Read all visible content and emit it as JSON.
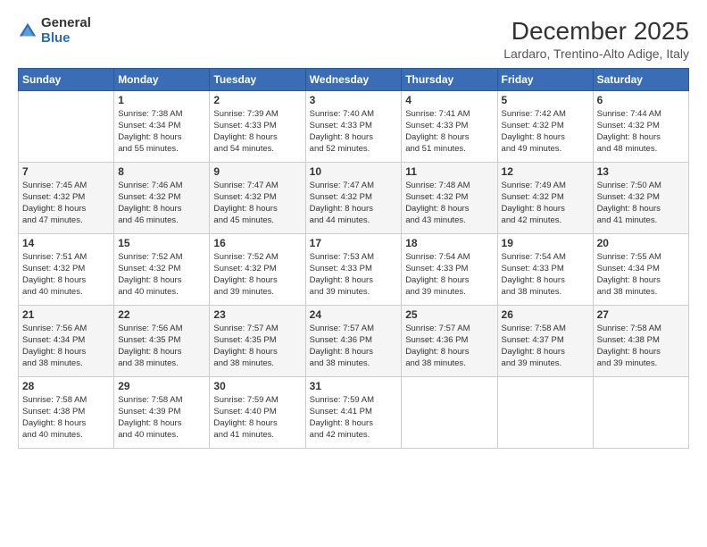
{
  "logo": {
    "general": "General",
    "blue": "Blue"
  },
  "header": {
    "month": "December 2025",
    "location": "Lardaro, Trentino-Alto Adige, Italy"
  },
  "weekdays": [
    "Sunday",
    "Monday",
    "Tuesday",
    "Wednesday",
    "Thursday",
    "Friday",
    "Saturday"
  ],
  "weeks": [
    [
      {
        "day": "",
        "info": ""
      },
      {
        "day": "1",
        "info": "Sunrise: 7:38 AM\nSunset: 4:34 PM\nDaylight: 8 hours\nand 55 minutes."
      },
      {
        "day": "2",
        "info": "Sunrise: 7:39 AM\nSunset: 4:33 PM\nDaylight: 8 hours\nand 54 minutes."
      },
      {
        "day": "3",
        "info": "Sunrise: 7:40 AM\nSunset: 4:33 PM\nDaylight: 8 hours\nand 52 minutes."
      },
      {
        "day": "4",
        "info": "Sunrise: 7:41 AM\nSunset: 4:33 PM\nDaylight: 8 hours\nand 51 minutes."
      },
      {
        "day": "5",
        "info": "Sunrise: 7:42 AM\nSunset: 4:32 PM\nDaylight: 8 hours\nand 49 minutes."
      },
      {
        "day": "6",
        "info": "Sunrise: 7:44 AM\nSunset: 4:32 PM\nDaylight: 8 hours\nand 48 minutes."
      }
    ],
    [
      {
        "day": "7",
        "info": "Sunrise: 7:45 AM\nSunset: 4:32 PM\nDaylight: 8 hours\nand 47 minutes."
      },
      {
        "day": "8",
        "info": "Sunrise: 7:46 AM\nSunset: 4:32 PM\nDaylight: 8 hours\nand 46 minutes."
      },
      {
        "day": "9",
        "info": "Sunrise: 7:47 AM\nSunset: 4:32 PM\nDaylight: 8 hours\nand 45 minutes."
      },
      {
        "day": "10",
        "info": "Sunrise: 7:47 AM\nSunset: 4:32 PM\nDaylight: 8 hours\nand 44 minutes."
      },
      {
        "day": "11",
        "info": "Sunrise: 7:48 AM\nSunset: 4:32 PM\nDaylight: 8 hours\nand 43 minutes."
      },
      {
        "day": "12",
        "info": "Sunrise: 7:49 AM\nSunset: 4:32 PM\nDaylight: 8 hours\nand 42 minutes."
      },
      {
        "day": "13",
        "info": "Sunrise: 7:50 AM\nSunset: 4:32 PM\nDaylight: 8 hours\nand 41 minutes."
      }
    ],
    [
      {
        "day": "14",
        "info": "Sunrise: 7:51 AM\nSunset: 4:32 PM\nDaylight: 8 hours\nand 40 minutes."
      },
      {
        "day": "15",
        "info": "Sunrise: 7:52 AM\nSunset: 4:32 PM\nDaylight: 8 hours\nand 40 minutes."
      },
      {
        "day": "16",
        "info": "Sunrise: 7:52 AM\nSunset: 4:32 PM\nDaylight: 8 hours\nand 39 minutes."
      },
      {
        "day": "17",
        "info": "Sunrise: 7:53 AM\nSunset: 4:33 PM\nDaylight: 8 hours\nand 39 minutes."
      },
      {
        "day": "18",
        "info": "Sunrise: 7:54 AM\nSunset: 4:33 PM\nDaylight: 8 hours\nand 39 minutes."
      },
      {
        "day": "19",
        "info": "Sunrise: 7:54 AM\nSunset: 4:33 PM\nDaylight: 8 hours\nand 38 minutes."
      },
      {
        "day": "20",
        "info": "Sunrise: 7:55 AM\nSunset: 4:34 PM\nDaylight: 8 hours\nand 38 minutes."
      }
    ],
    [
      {
        "day": "21",
        "info": "Sunrise: 7:56 AM\nSunset: 4:34 PM\nDaylight: 8 hours\nand 38 minutes."
      },
      {
        "day": "22",
        "info": "Sunrise: 7:56 AM\nSunset: 4:35 PM\nDaylight: 8 hours\nand 38 minutes."
      },
      {
        "day": "23",
        "info": "Sunrise: 7:57 AM\nSunset: 4:35 PM\nDaylight: 8 hours\nand 38 minutes."
      },
      {
        "day": "24",
        "info": "Sunrise: 7:57 AM\nSunset: 4:36 PM\nDaylight: 8 hours\nand 38 minutes."
      },
      {
        "day": "25",
        "info": "Sunrise: 7:57 AM\nSunset: 4:36 PM\nDaylight: 8 hours\nand 38 minutes."
      },
      {
        "day": "26",
        "info": "Sunrise: 7:58 AM\nSunset: 4:37 PM\nDaylight: 8 hours\nand 39 minutes."
      },
      {
        "day": "27",
        "info": "Sunrise: 7:58 AM\nSunset: 4:38 PM\nDaylight: 8 hours\nand 39 minutes."
      }
    ],
    [
      {
        "day": "28",
        "info": "Sunrise: 7:58 AM\nSunset: 4:38 PM\nDaylight: 8 hours\nand 40 minutes."
      },
      {
        "day": "29",
        "info": "Sunrise: 7:58 AM\nSunset: 4:39 PM\nDaylight: 8 hours\nand 40 minutes."
      },
      {
        "day": "30",
        "info": "Sunrise: 7:59 AM\nSunset: 4:40 PM\nDaylight: 8 hours\nand 41 minutes."
      },
      {
        "day": "31",
        "info": "Sunrise: 7:59 AM\nSunset: 4:41 PM\nDaylight: 8 hours\nand 42 minutes."
      },
      {
        "day": "",
        "info": ""
      },
      {
        "day": "",
        "info": ""
      },
      {
        "day": "",
        "info": ""
      }
    ]
  ]
}
